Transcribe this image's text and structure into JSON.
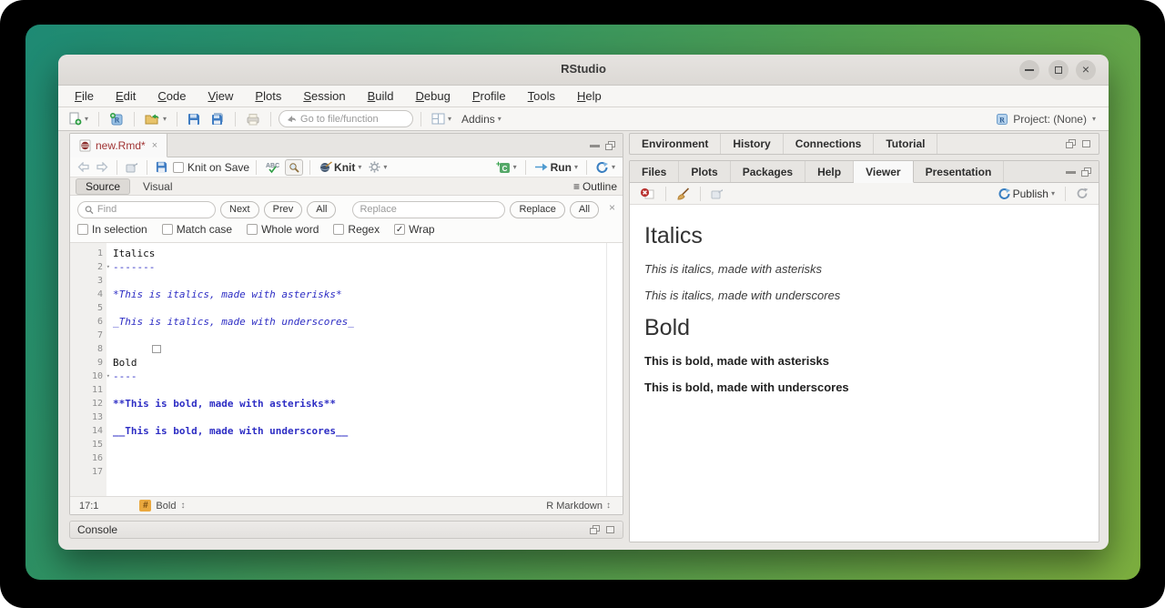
{
  "window": {
    "title": "RStudio"
  },
  "menubar": {
    "items": [
      "File",
      "Edit",
      "Code",
      "View",
      "Plots",
      "Session",
      "Build",
      "Debug",
      "Profile",
      "Tools",
      "Help"
    ]
  },
  "toolbar": {
    "goto_placeholder": "Go to file/function",
    "addins_label": "Addins",
    "project_label": "Project: (None)"
  },
  "source_pane": {
    "tab_title": "new.Rmd*",
    "toolbar": {
      "knit_on_save_label": "Knit on Save",
      "knit_label": "Knit",
      "run_label": "Run"
    },
    "modebar": {
      "source_label": "Source",
      "visual_label": "Visual",
      "outline_label": "Outline"
    },
    "find_bar": {
      "find_placeholder": "Find",
      "replace_placeholder": "Replace",
      "next_label": "Next",
      "prev_label": "Prev",
      "all_label": "All",
      "replace_label": "Replace",
      "replace_all_label": "All",
      "checkboxes": [
        {
          "label": "In selection",
          "checked": false
        },
        {
          "label": "Match case",
          "checked": false
        },
        {
          "label": "Whole word",
          "checked": false
        },
        {
          "label": "Regex",
          "checked": false
        },
        {
          "label": "Wrap",
          "checked": true
        }
      ]
    },
    "editor_lines": [
      {
        "num": 1,
        "text": "Italics",
        "style": "plain"
      },
      {
        "num": 2,
        "text": "-------",
        "style": "md",
        "fold": true
      },
      {
        "num": 3,
        "text": "",
        "style": "plain"
      },
      {
        "num": 4,
        "text": "*This is italics, made with asterisks*",
        "style": "md-italic"
      },
      {
        "num": 5,
        "text": "",
        "style": "plain"
      },
      {
        "num": 6,
        "text": "_This is italics, made with underscores_",
        "style": "md-italic"
      },
      {
        "num": 7,
        "text": "",
        "style": "plain"
      },
      {
        "num": 8,
        "text": "",
        "style": "plain"
      },
      {
        "num": 9,
        "text": "Bold",
        "style": "plain"
      },
      {
        "num": 10,
        "text": "----",
        "style": "md",
        "fold": true
      },
      {
        "num": 11,
        "text": "",
        "style": "plain"
      },
      {
        "num": 12,
        "text": "**This is bold, made with asterisks**",
        "style": "md-bold"
      },
      {
        "num": 13,
        "text": "",
        "style": "plain"
      },
      {
        "num": 14,
        "text": "__This is bold, made with underscores__",
        "style": "md-bold"
      },
      {
        "num": 15,
        "text": "",
        "style": "plain"
      },
      {
        "num": 16,
        "text": "",
        "style": "plain"
      },
      {
        "num": 17,
        "text": "",
        "style": "plain"
      }
    ],
    "status_bar": {
      "cursor_position": "17:1",
      "section_label": "Bold",
      "file_type": "R Markdown"
    }
  },
  "console_pane": {
    "title": "Console"
  },
  "environment_pane": {
    "tabs": [
      "Environment",
      "History",
      "Connections",
      "Tutorial"
    ]
  },
  "files_pane": {
    "tabs": [
      {
        "label": "Files",
        "active": false
      },
      {
        "label": "Plots",
        "active": false
      },
      {
        "label": "Packages",
        "active": false
      },
      {
        "label": "Help",
        "active": false
      },
      {
        "label": "Viewer",
        "active": true
      },
      {
        "label": "Presentation",
        "active": false
      }
    ],
    "toolbar": {
      "publish_label": "Publish"
    },
    "viewer": {
      "heading_italics": "Italics",
      "italic_asterisks": "This is italics, made with asterisks",
      "italic_underscores": "This is italics, made with underscores",
      "heading_bold": "Bold",
      "bold_asterisks": "This is bold, made with asterisks",
      "bold_underscores": "This is bold, made with underscores"
    }
  },
  "icons": {
    "dropdown": "▾",
    "close": "×",
    "check": "✓",
    "updown": "↕",
    "outline": "≡"
  },
  "colors": {
    "desktop_teal": "#1e8a74",
    "desktop_green": "#7daf3f",
    "code_markdown_blue": "#2d2dc4",
    "tab_title_red": "#a03434",
    "publish_blue": "#3a7fc1",
    "run_green": "#4c9b4c"
  }
}
